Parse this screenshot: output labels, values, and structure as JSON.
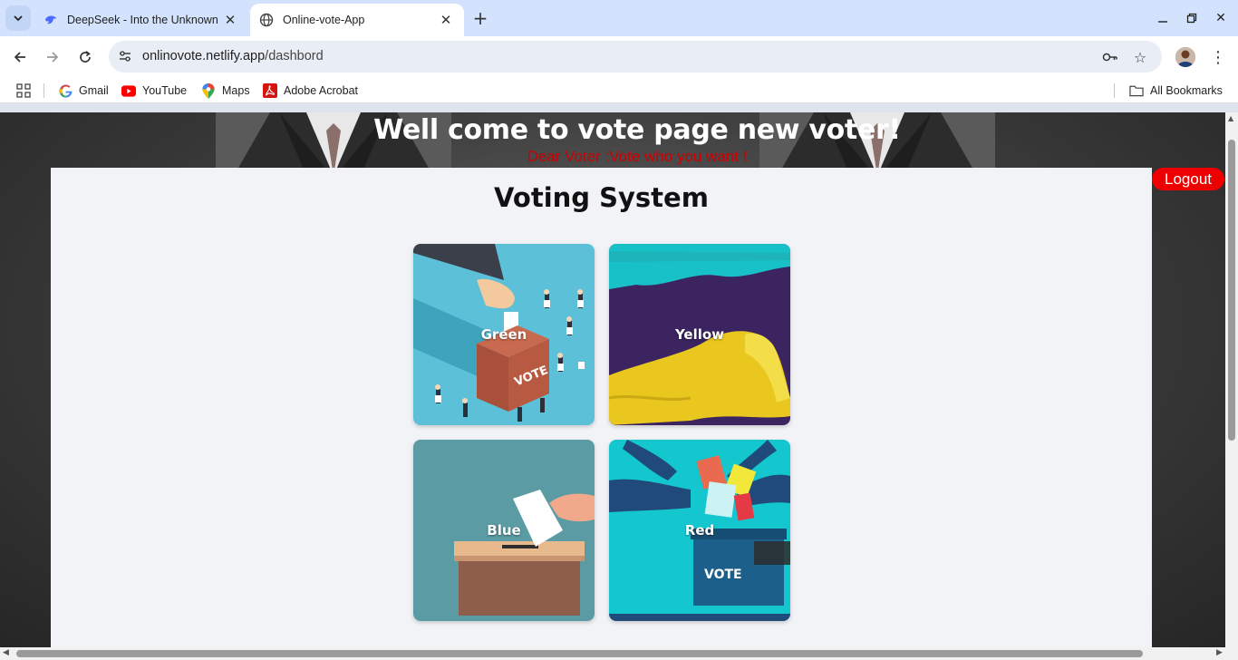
{
  "browser": {
    "tabs": [
      {
        "title": "DeepSeek - Into the Unknown",
        "active": false,
        "favicon": "deepseek-whale-icon"
      },
      {
        "title": "Online-vote-App",
        "active": true,
        "favicon": "globe-icon"
      }
    ],
    "url_host": "onlinovote.netlify.app",
    "url_path": "/dashbord",
    "bookmarks": [
      {
        "label": "Gmail",
        "icon": "google-icon"
      },
      {
        "label": "YouTube",
        "icon": "youtube-icon"
      },
      {
        "label": "Maps",
        "icon": "maps-icon"
      },
      {
        "label": "Adobe Acrobat",
        "icon": "acrobat-icon"
      }
    ],
    "all_bookmarks_label": "All Bookmarks"
  },
  "page": {
    "hero_title": "Well come to vote page new voter!",
    "hero_subtitle": "Dear Voter :Vote who you want !",
    "panel_title": "Voting System",
    "logout_label": "Logout",
    "cards": [
      {
        "label": "Green"
      },
      {
        "label": "Yellow"
      },
      {
        "label": "Blue"
      },
      {
        "label": "Red"
      }
    ]
  },
  "colors": {
    "accent_red": "#ee0000",
    "subtitle_red": "#cc0000",
    "panel_bg": "#f2f3f6",
    "tabstrip_bg": "#d3e3fd"
  }
}
